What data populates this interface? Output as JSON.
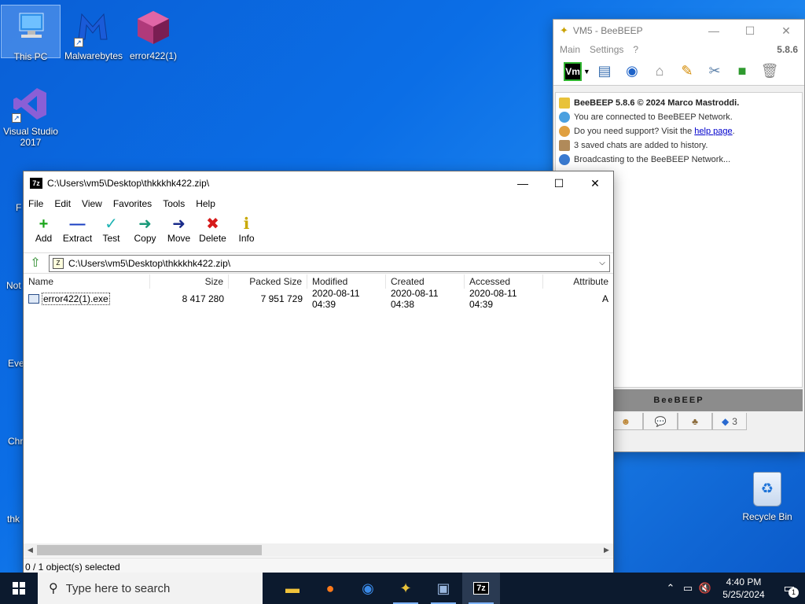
{
  "desktop": {
    "icons": [
      {
        "label": "This PC"
      },
      {
        "label": "Malwarebytes"
      },
      {
        "label": "error422(1)"
      },
      {
        "label": "Visual Studio 2017"
      }
    ],
    "partial_labels": [
      "F",
      "Not",
      "Eve",
      "Chr",
      "thk"
    ],
    "recycle_bin": {
      "label": "Recycle Bin"
    }
  },
  "sevenzip": {
    "title": "C:\\Users\\vm5\\Desktop\\thkkkhk422.zip\\",
    "menu": [
      "File",
      "Edit",
      "View",
      "Favorites",
      "Tools",
      "Help"
    ],
    "toolbar": [
      {
        "label": "Add",
        "icon": "+",
        "color": "#1aa51a"
      },
      {
        "label": "Extract",
        "icon": "—",
        "color": "#1a3fc2"
      },
      {
        "label": "Test",
        "icon": "✓",
        "color": "#1fb3b3"
      },
      {
        "label": "Copy",
        "icon": "➜",
        "color": "#1a9a7a"
      },
      {
        "label": "Move",
        "icon": "➜",
        "color": "#1a2b8a"
      },
      {
        "label": "Delete",
        "icon": "✖",
        "color": "#d61a1a"
      },
      {
        "label": "Info",
        "icon": "ℹ",
        "color": "#c8a800"
      }
    ],
    "address": "C:\\Users\\vm5\\Desktop\\thkkkhk422.zip\\",
    "columns": [
      "Name",
      "Size",
      "Packed Size",
      "Modified",
      "Created",
      "Accessed",
      "Attribute"
    ],
    "files": [
      {
        "name": "error422(1).exe",
        "size": "8 417 280",
        "packed": "7 951 729",
        "modified": "2020-08-11 04:39",
        "created": "2020-08-11 04:38",
        "accessed": "2020-08-11 04:39",
        "attr": "A"
      }
    ],
    "status": "0 / 1 object(s) selected"
  },
  "beebeep": {
    "title": "VM5 - BeeBEEP",
    "menu": [
      "Main",
      "Settings",
      "?"
    ],
    "version_badge": "5.8.6",
    "chat": {
      "header": "BeeBEEP 5.8.6 © 2024 Marco Mastroddi.",
      "connected": "You are connected to BeeBEEP Network.",
      "support_prefix": "Do you need support? Visit the",
      "support_link": "help page",
      "support_suffix": ".",
      "history": "3 saved chats are added to history.",
      "broadcast": "Broadcasting to the BeeBEEP Network..."
    },
    "brand": "BeeBEEP",
    "tab_count": "3"
  },
  "taskbar": {
    "search_placeholder": "Type here to search",
    "time": "4:40 PM",
    "date": "5/25/2024",
    "notification_count": "1"
  }
}
